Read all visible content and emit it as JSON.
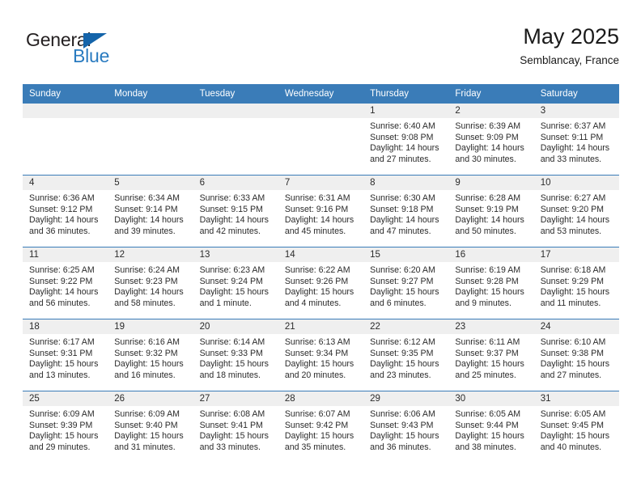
{
  "brand": {
    "name_part1": "General",
    "name_part2": "Blue",
    "triangle_color": "#1464aa",
    "blue_color": "#2a7bc0"
  },
  "header": {
    "title": "May 2025",
    "location": "Semblancay, France",
    "header_bg": "#3a7cb8"
  },
  "weekdays": [
    "Sunday",
    "Monday",
    "Tuesday",
    "Wednesday",
    "Thursday",
    "Friday",
    "Saturday"
  ],
  "weeks": [
    [
      {
        "day": "",
        "sunrise": "",
        "sunset": "",
        "daylight1": "",
        "daylight2": ""
      },
      {
        "day": "",
        "sunrise": "",
        "sunset": "",
        "daylight1": "",
        "daylight2": ""
      },
      {
        "day": "",
        "sunrise": "",
        "sunset": "",
        "daylight1": "",
        "daylight2": ""
      },
      {
        "day": "",
        "sunrise": "",
        "sunset": "",
        "daylight1": "",
        "daylight2": ""
      },
      {
        "day": "1",
        "sunrise": "Sunrise: 6:40 AM",
        "sunset": "Sunset: 9:08 PM",
        "daylight1": "Daylight: 14 hours",
        "daylight2": "and 27 minutes."
      },
      {
        "day": "2",
        "sunrise": "Sunrise: 6:39 AM",
        "sunset": "Sunset: 9:09 PM",
        "daylight1": "Daylight: 14 hours",
        "daylight2": "and 30 minutes."
      },
      {
        "day": "3",
        "sunrise": "Sunrise: 6:37 AM",
        "sunset": "Sunset: 9:11 PM",
        "daylight1": "Daylight: 14 hours",
        "daylight2": "and 33 minutes."
      }
    ],
    [
      {
        "day": "4",
        "sunrise": "Sunrise: 6:36 AM",
        "sunset": "Sunset: 9:12 PM",
        "daylight1": "Daylight: 14 hours",
        "daylight2": "and 36 minutes."
      },
      {
        "day": "5",
        "sunrise": "Sunrise: 6:34 AM",
        "sunset": "Sunset: 9:14 PM",
        "daylight1": "Daylight: 14 hours",
        "daylight2": "and 39 minutes."
      },
      {
        "day": "6",
        "sunrise": "Sunrise: 6:33 AM",
        "sunset": "Sunset: 9:15 PM",
        "daylight1": "Daylight: 14 hours",
        "daylight2": "and 42 minutes."
      },
      {
        "day": "7",
        "sunrise": "Sunrise: 6:31 AM",
        "sunset": "Sunset: 9:16 PM",
        "daylight1": "Daylight: 14 hours",
        "daylight2": "and 45 minutes."
      },
      {
        "day": "8",
        "sunrise": "Sunrise: 6:30 AM",
        "sunset": "Sunset: 9:18 PM",
        "daylight1": "Daylight: 14 hours",
        "daylight2": "and 47 minutes."
      },
      {
        "day": "9",
        "sunrise": "Sunrise: 6:28 AM",
        "sunset": "Sunset: 9:19 PM",
        "daylight1": "Daylight: 14 hours",
        "daylight2": "and 50 minutes."
      },
      {
        "day": "10",
        "sunrise": "Sunrise: 6:27 AM",
        "sunset": "Sunset: 9:20 PM",
        "daylight1": "Daylight: 14 hours",
        "daylight2": "and 53 minutes."
      }
    ],
    [
      {
        "day": "11",
        "sunrise": "Sunrise: 6:25 AM",
        "sunset": "Sunset: 9:22 PM",
        "daylight1": "Daylight: 14 hours",
        "daylight2": "and 56 minutes."
      },
      {
        "day": "12",
        "sunrise": "Sunrise: 6:24 AM",
        "sunset": "Sunset: 9:23 PM",
        "daylight1": "Daylight: 14 hours",
        "daylight2": "and 58 minutes."
      },
      {
        "day": "13",
        "sunrise": "Sunrise: 6:23 AM",
        "sunset": "Sunset: 9:24 PM",
        "daylight1": "Daylight: 15 hours",
        "daylight2": "and 1 minute."
      },
      {
        "day": "14",
        "sunrise": "Sunrise: 6:22 AM",
        "sunset": "Sunset: 9:26 PM",
        "daylight1": "Daylight: 15 hours",
        "daylight2": "and 4 minutes."
      },
      {
        "day": "15",
        "sunrise": "Sunrise: 6:20 AM",
        "sunset": "Sunset: 9:27 PM",
        "daylight1": "Daylight: 15 hours",
        "daylight2": "and 6 minutes."
      },
      {
        "day": "16",
        "sunrise": "Sunrise: 6:19 AM",
        "sunset": "Sunset: 9:28 PM",
        "daylight1": "Daylight: 15 hours",
        "daylight2": "and 9 minutes."
      },
      {
        "day": "17",
        "sunrise": "Sunrise: 6:18 AM",
        "sunset": "Sunset: 9:29 PM",
        "daylight1": "Daylight: 15 hours",
        "daylight2": "and 11 minutes."
      }
    ],
    [
      {
        "day": "18",
        "sunrise": "Sunrise: 6:17 AM",
        "sunset": "Sunset: 9:31 PM",
        "daylight1": "Daylight: 15 hours",
        "daylight2": "and 13 minutes."
      },
      {
        "day": "19",
        "sunrise": "Sunrise: 6:16 AM",
        "sunset": "Sunset: 9:32 PM",
        "daylight1": "Daylight: 15 hours",
        "daylight2": "and 16 minutes."
      },
      {
        "day": "20",
        "sunrise": "Sunrise: 6:14 AM",
        "sunset": "Sunset: 9:33 PM",
        "daylight1": "Daylight: 15 hours",
        "daylight2": "and 18 minutes."
      },
      {
        "day": "21",
        "sunrise": "Sunrise: 6:13 AM",
        "sunset": "Sunset: 9:34 PM",
        "daylight1": "Daylight: 15 hours",
        "daylight2": "and 20 minutes."
      },
      {
        "day": "22",
        "sunrise": "Sunrise: 6:12 AM",
        "sunset": "Sunset: 9:35 PM",
        "daylight1": "Daylight: 15 hours",
        "daylight2": "and 23 minutes."
      },
      {
        "day": "23",
        "sunrise": "Sunrise: 6:11 AM",
        "sunset": "Sunset: 9:37 PM",
        "daylight1": "Daylight: 15 hours",
        "daylight2": "and 25 minutes."
      },
      {
        "day": "24",
        "sunrise": "Sunrise: 6:10 AM",
        "sunset": "Sunset: 9:38 PM",
        "daylight1": "Daylight: 15 hours",
        "daylight2": "and 27 minutes."
      }
    ],
    [
      {
        "day": "25",
        "sunrise": "Sunrise: 6:09 AM",
        "sunset": "Sunset: 9:39 PM",
        "daylight1": "Daylight: 15 hours",
        "daylight2": "and 29 minutes."
      },
      {
        "day": "26",
        "sunrise": "Sunrise: 6:09 AM",
        "sunset": "Sunset: 9:40 PM",
        "daylight1": "Daylight: 15 hours",
        "daylight2": "and 31 minutes."
      },
      {
        "day": "27",
        "sunrise": "Sunrise: 6:08 AM",
        "sunset": "Sunset: 9:41 PM",
        "daylight1": "Daylight: 15 hours",
        "daylight2": "and 33 minutes."
      },
      {
        "day": "28",
        "sunrise": "Sunrise: 6:07 AM",
        "sunset": "Sunset: 9:42 PM",
        "daylight1": "Daylight: 15 hours",
        "daylight2": "and 35 minutes."
      },
      {
        "day": "29",
        "sunrise": "Sunrise: 6:06 AM",
        "sunset": "Sunset: 9:43 PM",
        "daylight1": "Daylight: 15 hours",
        "daylight2": "and 36 minutes."
      },
      {
        "day": "30",
        "sunrise": "Sunrise: 6:05 AM",
        "sunset": "Sunset: 9:44 PM",
        "daylight1": "Daylight: 15 hours",
        "daylight2": "and 38 minutes."
      },
      {
        "day": "31",
        "sunrise": "Sunrise: 6:05 AM",
        "sunset": "Sunset: 9:45 PM",
        "daylight1": "Daylight: 15 hours",
        "daylight2": "and 40 minutes."
      }
    ]
  ]
}
